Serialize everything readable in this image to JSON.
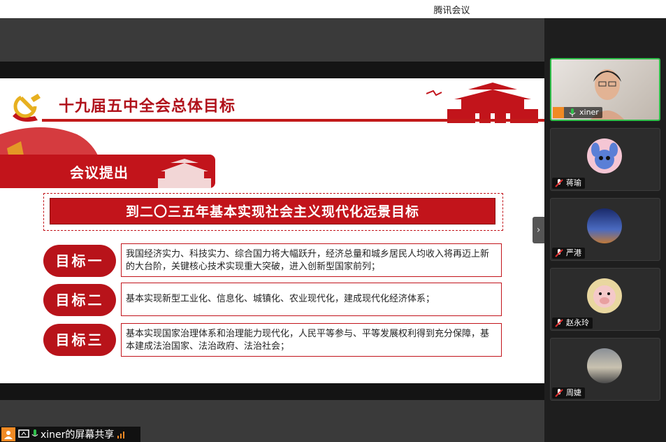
{
  "window": {
    "title": "腾讯会议"
  },
  "slide": {
    "title": "十九届五中全会总体目标",
    "banner": "会议提出",
    "goal_headline": "到二〇三五年基本实现社会主义现代化远景目标",
    "goals": [
      {
        "label": "目标一",
        "text": "我国经济实力、科技实力、综合国力将大幅跃升，经济总量和城乡居民人均收入将再迈上新的大台阶，关键核心技术实现重大突破，进入创新型国家前列；"
      },
      {
        "label": "目标二",
        "text": "基本实现新型工业化、信息化、城镇化、农业现代化，建成现代化经济体系；"
      },
      {
        "label": "目标三",
        "text": "基本实现国家治理体系和治理能力现代化，人民平等参与、平等发展权利得到充分保障，基本建成法治国家、法治政府、法治社会；"
      }
    ]
  },
  "participants": [
    {
      "name": "xiner",
      "active": true
    },
    {
      "name": "蒋瑜",
      "active": false
    },
    {
      "name": "严港",
      "active": false
    },
    {
      "name": "赵永玲",
      "active": false
    },
    {
      "name": "周婕",
      "active": false
    }
  ],
  "screen_share": {
    "label": "xiner的屏幕共享"
  },
  "colors": {
    "accent": "#c2141b",
    "active_border": "#2fbf4a",
    "share_icon": "#f08a24"
  }
}
